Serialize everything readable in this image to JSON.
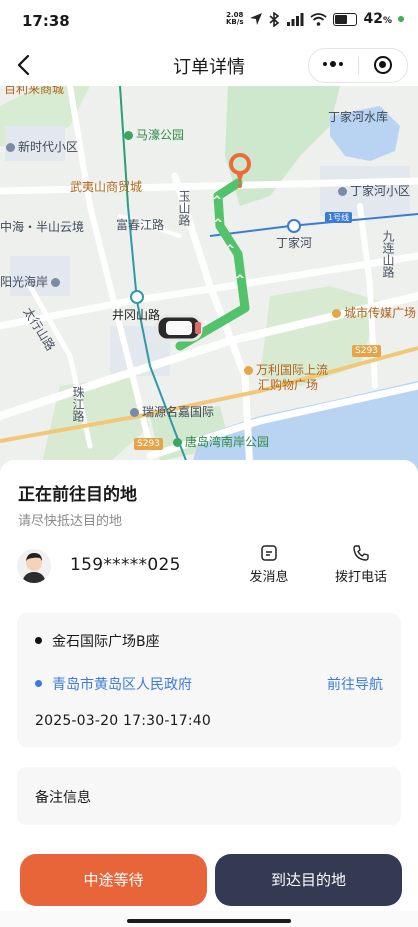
{
  "status_bar": {
    "time": "17:38",
    "net_speed_value": "2.08",
    "net_speed_unit": "KB/s",
    "battery": "42",
    "battery_unit": "%"
  },
  "nav": {
    "title": "订单详情"
  },
  "map": {
    "labels": {
      "top_cut": "百利来商城",
      "xinshidai": "新时代小区",
      "mahao": "马濠公园",
      "dingjiahe_reservoir": "丁家河水库",
      "wuyishan": "武夷山商贸城",
      "dingjiahe_community": "丁家河小区",
      "zhonghai": "中海・半山云境",
      "fuchun_road": "富春江路",
      "yushan_road": "玉山路",
      "dingjiahe_station": "丁家河",
      "line1": "1号线",
      "jiuzhishan_road": "九连山路",
      "yangguang": "阳光海岸",
      "jinggang_road": "井冈山路",
      "chengshi_media": "城市传媒广场",
      "taihang_road": "太行山路",
      "s293_right": "S293",
      "wanli_1": "万利国际上流",
      "wanli_2": "汇购物广场",
      "zhuhai_road": "珠江路",
      "ruiyuan": "瑞源名嘉国际",
      "s293_left": "S293",
      "tangdao": "唐岛湾南岸公园"
    },
    "colors": {
      "route": "#52c26b",
      "pin": "#ec6a3b",
      "water": "#b9d4f3",
      "park": "#cde8cc"
    }
  },
  "order": {
    "status_title": "正在前往目的地",
    "status_subtitle": "请尽快抵达目的地",
    "passenger_phone": "159*****025",
    "message_label": "发消息",
    "call_label": "拨打电话",
    "origin": "金石国际广场B座",
    "destination": "青岛市黄岛区人民政府",
    "navigate_label": "前往导航",
    "time_range": "2025-03-20 17:30-17:40",
    "remark_label": "备注信息"
  },
  "buttons": {
    "wait_label": "中途等待",
    "arrive_label": "到达目的地"
  },
  "colors": {
    "wait_button": "#e8653a",
    "arrive_button": "#343a52",
    "link": "#3d7bd9"
  }
}
